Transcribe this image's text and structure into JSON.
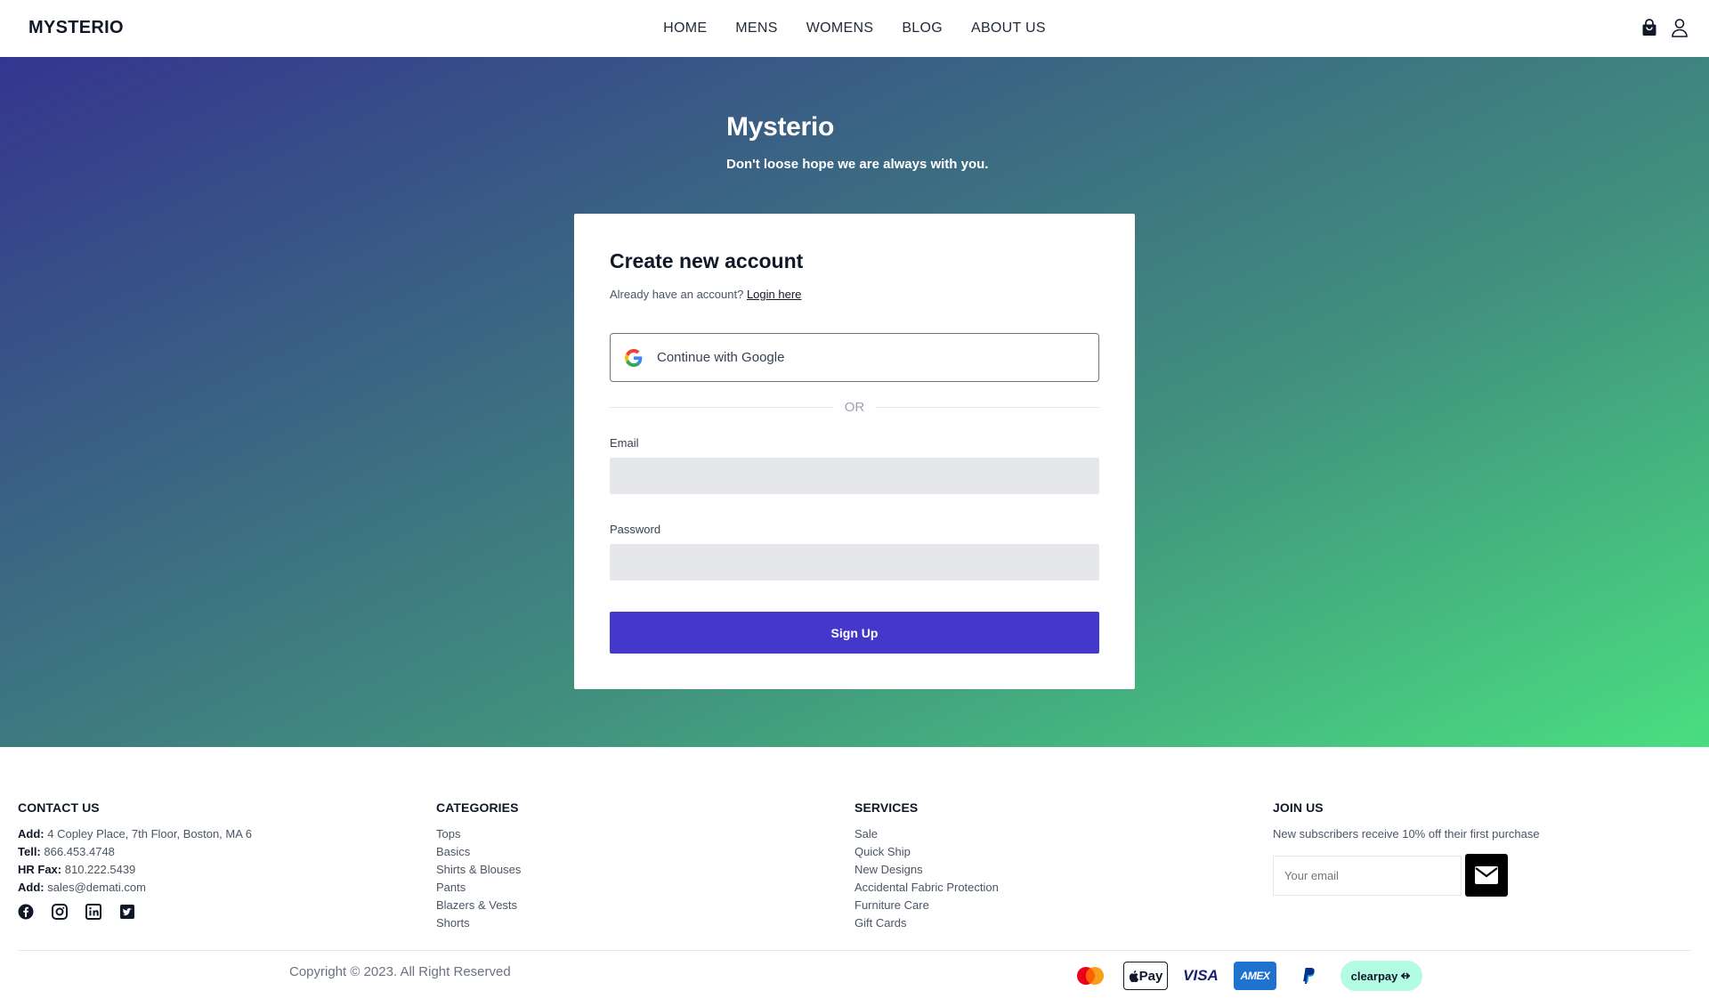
{
  "header": {
    "brand": "MYSTERIO",
    "nav": [
      "HOME",
      "MENS",
      "WOMENS",
      "BLOG",
      "ABOUT US"
    ],
    "icons": [
      "shopping-bag-icon",
      "user-icon"
    ]
  },
  "hero": {
    "title": "Mysterio",
    "subtitle": "Don't loose hope we are always with you."
  },
  "signup_form": {
    "title": "Create new account",
    "login_prompt": "Already have an account?",
    "login_link": "Login here",
    "google_label": "Continue with Google",
    "divider_text": "OR",
    "email_label": "Email",
    "email_value": "",
    "password_label": "Password",
    "password_value": "",
    "submit_label": "Sign Up",
    "accent_color": "#4338ca"
  },
  "footer": {
    "contact": {
      "heading": "CONTACT US",
      "rows": [
        {
          "label": "Add:",
          "value": "4 Copley Place, 7th Floor, Boston, MA 6"
        },
        {
          "label": "Tell:",
          "value": "866.453.4748"
        },
        {
          "label": "HR Fax:",
          "value": "810.222.5439"
        },
        {
          "label": "Add:",
          "value": "sales@demati.com"
        }
      ],
      "social_icons": [
        "facebook-icon",
        "instagram-icon",
        "linkedin-icon",
        "twitter-icon"
      ]
    },
    "categories": {
      "heading": "CATEGORIES",
      "items": [
        "Tops",
        "Basics",
        "Shirts & Blouses",
        "Pants",
        "Blazers & Vests",
        "Shorts"
      ]
    },
    "services": {
      "heading": "SERVICES",
      "items": [
        "Sale",
        "Quick Ship",
        "New Designs",
        "Accidental Fabric Protection",
        "Furniture Care",
        "Gift Cards"
      ]
    },
    "join": {
      "heading": "JOIN US",
      "description": "New subscribers receive 10% off their first purchase",
      "email_placeholder": "Your email"
    },
    "copyright": "Copyright © 2023. All Right Reserved",
    "payments": {
      "applepay": "Pay",
      "visa": "VISA",
      "amex": "AMEX",
      "clearpay": "clearpay"
    }
  }
}
